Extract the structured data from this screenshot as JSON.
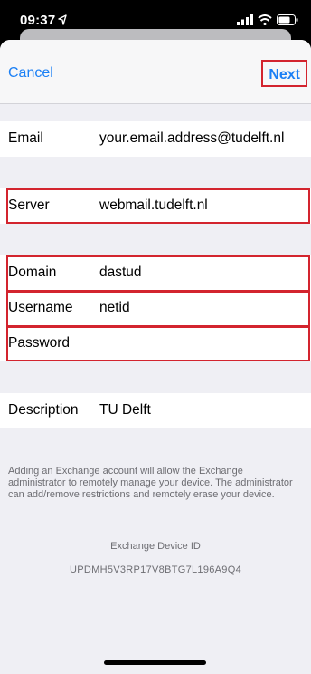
{
  "status_bar": {
    "time": "09:37"
  },
  "nav": {
    "cancel_label": "Cancel",
    "next_label": "Next"
  },
  "form": {
    "email_label": "Email",
    "email_value": "your.email.address@tudelft.nl",
    "server_label": "Server",
    "server_value": "webmail.tudelft.nl",
    "domain_label": "Domain",
    "domain_value": "dastud",
    "username_label": "Username",
    "username_value": "netid",
    "password_label": "Password",
    "password_value": "",
    "description_label": "Description",
    "description_value": "TU Delft"
  },
  "footer": {
    "info_text": "Adding an Exchange account will allow the Exchange administrator to remotely manage your device. The administrator can add/remove restrictions and remotely erase your device.",
    "device_id_label": "Exchange Device ID",
    "device_id_value": "UPDMH5V3RP17V8BTG7L196A9Q4"
  },
  "colors": {
    "accent": "#1a7ff5",
    "highlight": "#d3242e"
  }
}
